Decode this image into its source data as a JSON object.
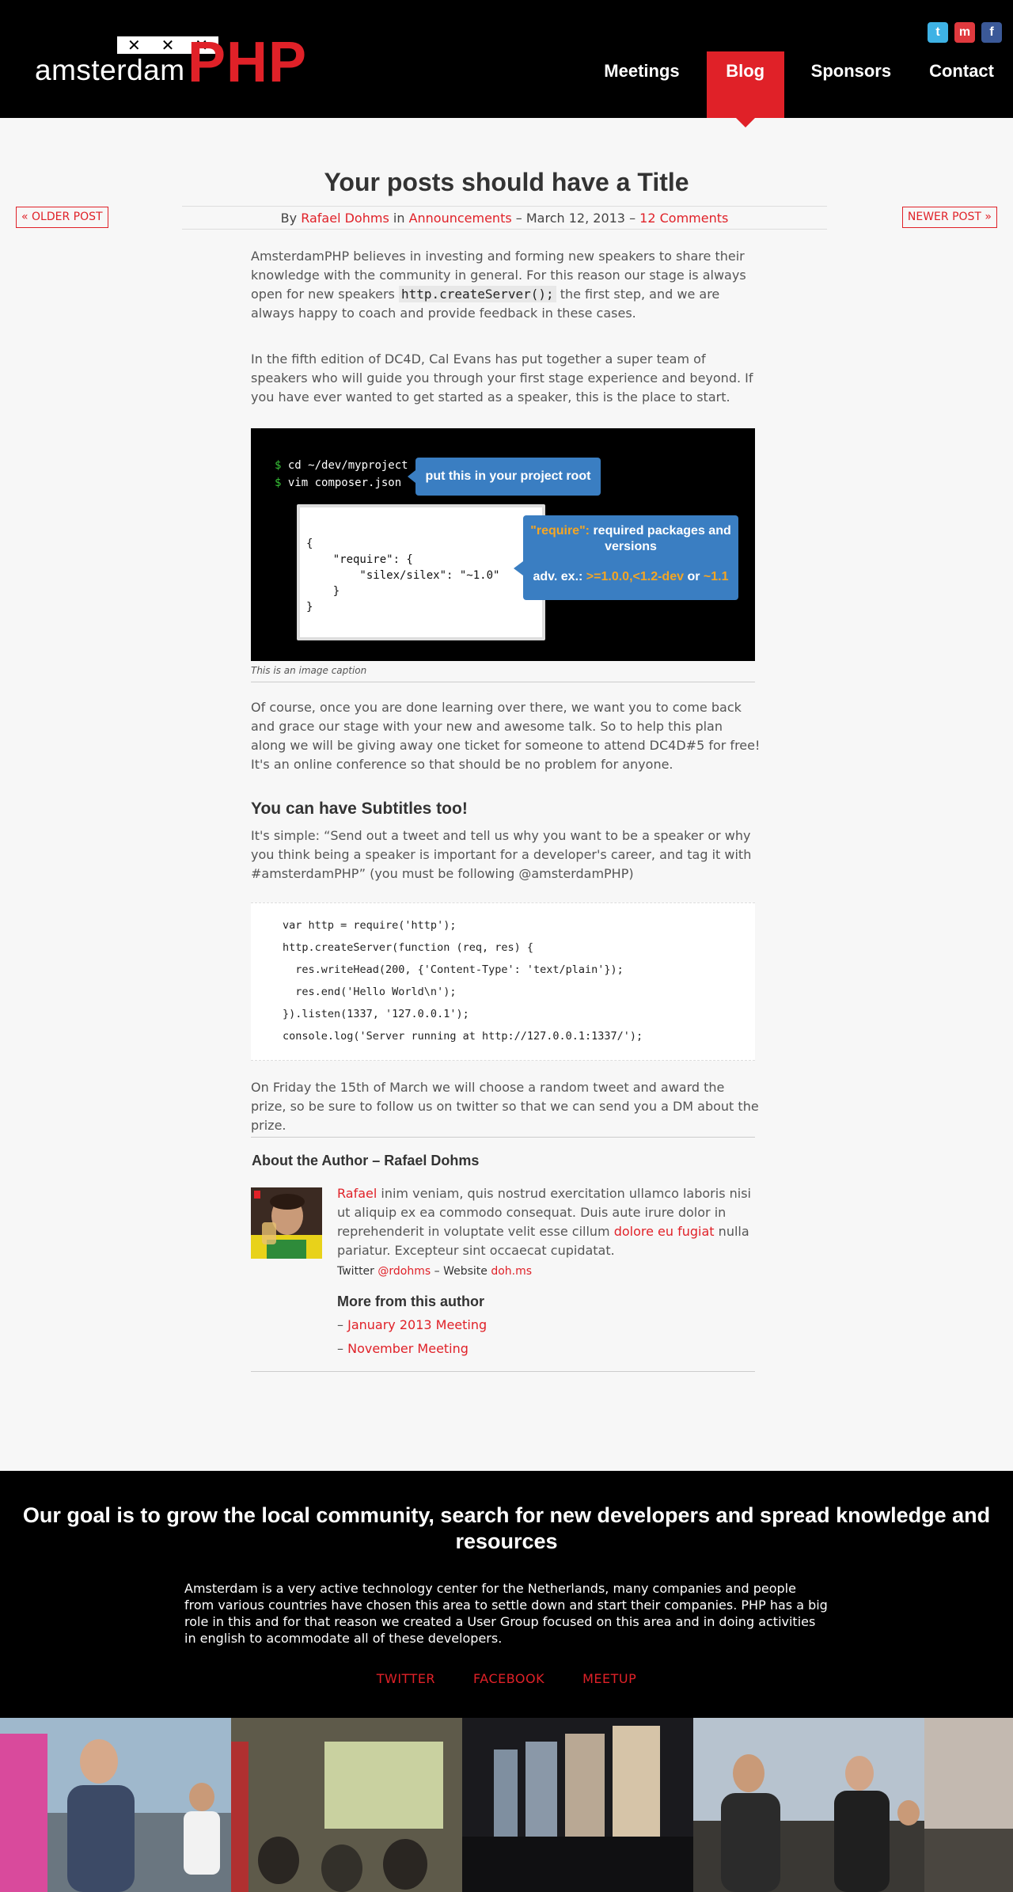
{
  "header": {
    "logo_small": "amsterdam",
    "logo_big": "PHP",
    "crosses": [
      "✕",
      "✕",
      "✕"
    ],
    "social": [
      {
        "icon": "twitter-icon",
        "glyph": "t"
      },
      {
        "icon": "meetup-icon",
        "glyph": "m"
      },
      {
        "icon": "facebook-icon",
        "glyph": "f"
      }
    ],
    "nav": [
      "Meetings",
      "Blog",
      "Sponsors",
      "Contact"
    ],
    "active_nav": "Blog"
  },
  "post": {
    "title": "Your posts should have a Title",
    "meta": {
      "by": "By",
      "author": "Rafael Dohms",
      "in": "in",
      "category": "Announcements",
      "date": "– March 12, 2013 –",
      "comments": "12 Comments"
    },
    "older": "« Older Post",
    "newer": "Newer Post »",
    "p1_a": "AmsterdamPHP believes in investing and forming new speakers to share their knowledge with the community in general. For this reason our stage is always open for new speakers",
    "p1_code": "http.createServer();",
    "p1_b": "the first step, and we are always happy to coach and provide feedback in these cases.",
    "p2": "In the fifth edition of DC4D, Cal Evans has put together a super team of speakers who will guide you through your first stage experience and beyond. If you have ever wanted to get started as a speaker, this is the place to start.",
    "figure": {
      "term_line1_prompt": "$",
      "term_line1": "cd ~/dev/myproject",
      "term_line2_prompt": "$",
      "term_line2": "vim composer.json",
      "bubble1": "put this in your project root",
      "json_lines": [
        "{",
        "    \"require\": {",
        "        \"silex/silex\": \"~1.0\"",
        "    }",
        "}"
      ],
      "bubble2_key": "\"require\":",
      "bubble2_text": "required packages and versions",
      "bubble2_adv": "adv. ex.:",
      "bubble2_ex": ">=1.0.0,<1.2-dev",
      "bubble2_or": "or",
      "bubble2_ex2": "~1.1"
    },
    "caption": "This is an image caption",
    "p3": "Of course, once you are done learning over there, we want you to come back and grace our stage with your new and awesome talk. So to help this plan along we will be giving away one ticket for someone to attend DC4D#5 for free! It's an online conference so that should be no problem for anyone.",
    "subtitle": "You can have Subtitles too!",
    "p4": "It's simple: “Send out a tweet and tell us why you want to be a  speaker or why you think being a speaker is important for a developer's career, and tag it with #amsterdamPHP” (you must be following @amsterdamPHP)",
    "code": [
      "var http = require('http');",
      "http.createServer(function (req, res) {",
      "  res.writeHead(200, {'Content-Type': 'text/plain'});",
      "  res.end('Hello World\\n');",
      "}).listen(1337, '127.0.0.1');",
      "console.log('Server running at http://127.0.0.1:1337/');"
    ],
    "p5": "On Friday the 15th of March we will choose a random tweet and award the prize, so be sure to follow us on twitter so that we can send you a DM about the prize."
  },
  "author": {
    "heading": "About the Author – Rafael Dohms",
    "bio_name": "Rafael",
    "bio_a": "inim veniam, quis nostrud exercitation ullamco laboris nisi ut aliquip ex ea commodo consequat. Duis aute irure dolor in reprehenderit in voluptate velit esse cillum",
    "bio_link": "dolore eu fugiat",
    "bio_b": "nulla pariatur. Excepteur sint occaecat cupidatat.",
    "twitter_label": "Twitter",
    "twitter": "@rdohms",
    "sep": "–",
    "website_label": "Website",
    "website": "doh.ms",
    "more_heading": "More from this author",
    "more": [
      "January 2013 Meeting",
      "November Meeting"
    ],
    "dash": "–"
  },
  "footer": {
    "heading": "Our goal is to grow the local community, search for new developers and spread knowledge and resources",
    "text": "Amsterdam is a very active technology center for the Netherlands, many companies and people from various countries have chosen this area to settle down and start their companies. PHP has a big role in this and for that reason we created a User Group focused on this area and in doing activities in english to acommodate all of these developers.",
    "links": [
      "Twitter",
      "Facebook",
      "Meetup"
    ]
  },
  "colors": {
    "brand_red": "#e02128",
    "bubble_blue": "#3a7ec2",
    "highlight_orange": "#f5a623"
  }
}
